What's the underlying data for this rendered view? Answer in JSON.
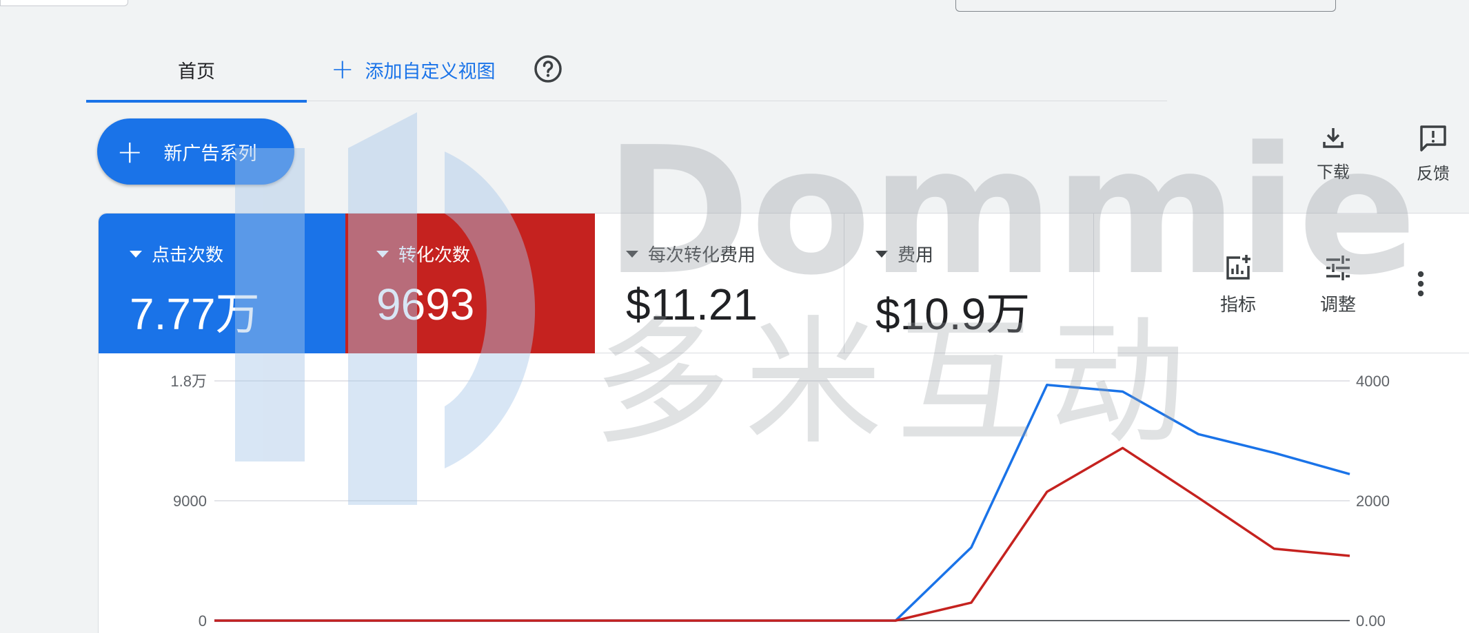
{
  "tabs": {
    "home_label": "首页",
    "add_view_label": "添加自定义视图"
  },
  "new_campaign_label": "新广告系列",
  "actions": {
    "download_label": "下载",
    "feedback_label": "反馈"
  },
  "metrics": [
    {
      "label": "点击次数",
      "value": "7.77万",
      "color": "#1a73e8"
    },
    {
      "label": "转化次数",
      "value": "9693",
      "color": "#c5221f"
    },
    {
      "label": "每次转化费用",
      "value": "$11.21"
    },
    {
      "label": "费用",
      "value": "$10.9万"
    }
  ],
  "tools": {
    "metrics_label": "指标",
    "adjust_label": "调整"
  },
  "watermark": {
    "brand": "Dommie",
    "chinese": "多米互动"
  },
  "chart_data": {
    "type": "line",
    "x": [
      0,
      1,
      2,
      3,
      4,
      5,
      6,
      7,
      8,
      9,
      10,
      11,
      12,
      13,
      14,
      15
    ],
    "series": [
      {
        "color": "#1a73e8",
        "axis": "left",
        "values": [
          0,
          0,
          0,
          0,
          0,
          0,
          0,
          0,
          0,
          0,
          5500,
          17700,
          17200,
          14000,
          12600,
          11000
        ]
      },
      {
        "color": "#c5221f",
        "axis": "right",
        "values": [
          0,
          0,
          0,
          0,
          0,
          0,
          0,
          0,
          0,
          0,
          300,
          2150,
          2880,
          2050,
          1200,
          1080
        ]
      }
    ],
    "y_left_ticks": [
      "1.8万",
      "9000",
      "0"
    ],
    "y_left_range": [
      0,
      18000
    ],
    "y_right_ticks": [
      "4000",
      "2000",
      "0.00"
    ],
    "y_right_range": [
      0,
      4000
    ],
    "grid": true
  }
}
